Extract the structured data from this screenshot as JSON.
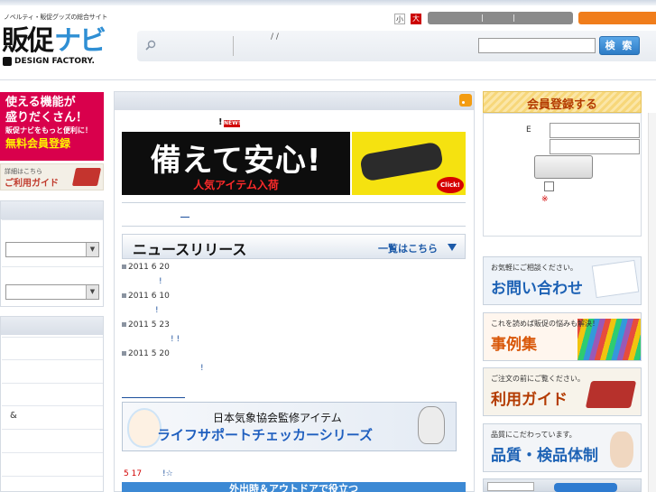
{
  "header": {
    "tagline": "ノベルティ・販促グッズの総合サイト",
    "logo_kanji": "販促",
    "logo_navi": "ナビ",
    "logo_company": "DESIGN FACTORY.",
    "font_small": "小",
    "font_large": "大",
    "search_slashes": "/ /",
    "search_button": "検 索"
  },
  "left": {
    "promo": {
      "line1": "使える機能が",
      "line2": "盛りだくさん！",
      "line3": "販促ナビをもっと便利に！",
      "line4": "無料会員登録"
    },
    "guide": {
      "small": "詳細はこちら",
      "big": "ご利用ガイド"
    },
    "amp": "&"
  },
  "center": {
    "flag": "!",
    "new_badge": "NEW!",
    "banner_main_title": "備えて安心!",
    "banner_main_sub": "人気アイテム入荷",
    "banner_side_click": "Click!",
    "news_title": "ニュースリリース",
    "news_more": "一覧はこちら",
    "news": [
      {
        "date": "2011  6 20",
        "text": "!"
      },
      {
        "date": "2011  6 10",
        "text": "!"
      },
      {
        "date": "2011  5 23",
        "text": "!              !"
      },
      {
        "date": "2011  5 20",
        "text": "!"
      }
    ],
    "life_banner_top": "日本気象協会監修アイテム",
    "life_banner_main": "ライフサポートチェッカーシリーズ",
    "date_517": "5 17",
    "bang_517": "!☆",
    "bottom_banner": "外出時＆アウトドアで役立つ"
  },
  "right": {
    "register_title": "会員登録する",
    "email_label": "E",
    "required_mark": "※",
    "contact_small": "お気軽にご相談ください。",
    "contact_big": "お問い合わせ",
    "cases_small": "これを読めば販促の悩みも解決！",
    "cases_big": "事例集",
    "guide_small": "ご注文の前にご覧ください。",
    "guide_big": "利用ガイド",
    "quality_small": "品質にこだわっています。",
    "quality_big": "品質・検品体制"
  },
  "colors": {
    "brand_blue": "#2f8fd4",
    "promo_pink": "#d9004c",
    "accent_orange": "#f07d1b",
    "link_blue": "#1b4f9c"
  }
}
